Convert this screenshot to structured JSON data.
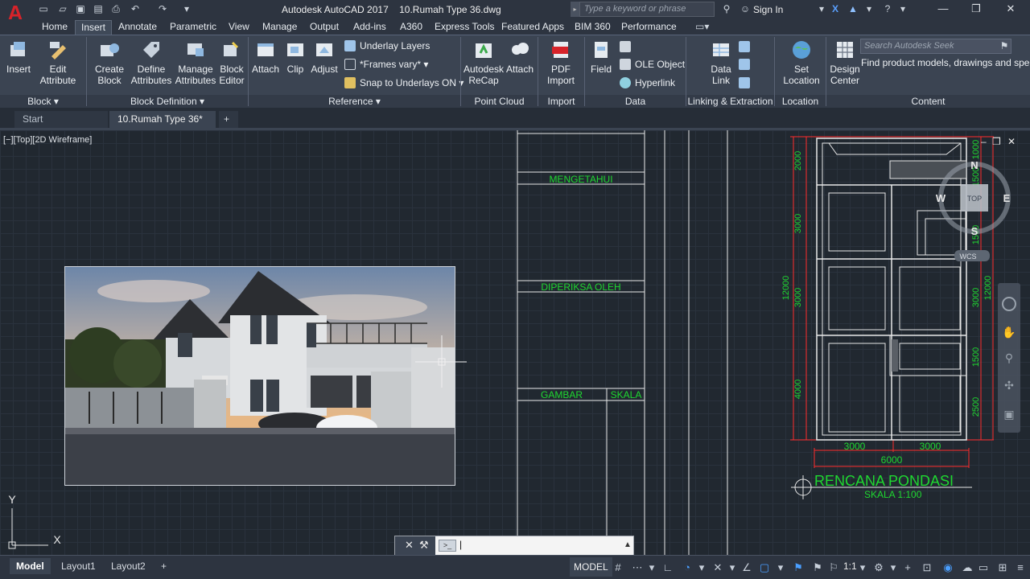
{
  "app": {
    "logo": "A",
    "title": "Autodesk AutoCAD 2017    10.Rumah Type 36.dwg",
    "search_placeholder": "Type a keyword or phrase",
    "sign_in": "Sign In"
  },
  "ribbon_tabs": [
    "Home",
    "Insert",
    "Annotate",
    "Parametric",
    "View",
    "Manage",
    "Output",
    "Add-ins",
    "A360",
    "Express Tools",
    "Featured Apps",
    "BIM 360",
    "Performance"
  ],
  "active_tab": "Insert",
  "ribbon": {
    "insert": "Insert",
    "edit_attribute": "Edit\nAttribute",
    "create_block": "Create\nBlock",
    "define_attributes": "Define\nAttributes",
    "manage_attributes": "Manage\nAttributes",
    "block_editor": "Block\nEditor",
    "attach": "Attach",
    "clip": "Clip",
    "adjust": "Adjust",
    "underlay_layers": "Underlay Layers",
    "frames_vary": "*Frames vary*",
    "snap_to_underlays": "Snap to Underlays ON",
    "autodesk_recap": "Autodesk\nReCap",
    "attach_pc": "Attach",
    "pdf_import": "PDF\nImport",
    "field": "Field",
    "ole_object": "OLE Object",
    "hyperlink": "Hyperlink",
    "data_link": "Data\nLink",
    "set_location": "Set\nLocation",
    "design_center": "Design\nCenter",
    "seek_placeholder": "Search Autodesk Seek",
    "seek_text": "Find product models, drawings and specs",
    "panels": [
      "Block",
      "Block Definition",
      "Reference",
      "Point Cloud",
      "Import",
      "Data",
      "Linking & Extraction",
      "Location",
      "Content"
    ]
  },
  "file_tabs": {
    "start": "Start",
    "current": "10.Rumah Type 36*"
  },
  "viewport_label": "[−][Top][2D Wireframe]",
  "drawing": {
    "title_block": [
      "MENGETAHUI",
      "DIPERIKSA  OLEH",
      "GAMBAR",
      "SKALA"
    ],
    "plan_title": "RENCANA PONDASI",
    "plan_scale": "SKALA  1:100",
    "dims_left": [
      "2000",
      "3000",
      "12000",
      "3000",
      "4000"
    ],
    "dims_right": [
      "1000",
      "1500",
      "1500",
      "12000",
      "3000",
      "1500",
      "2500"
    ],
    "dims_bottom": [
      "3000",
      "3000",
      "6000"
    ],
    "viewcube": {
      "top": "TOP",
      "n": "N",
      "s": "S",
      "e": "E",
      "w": "W",
      "wcs": "WCS"
    },
    "ucs": {
      "y": "Y",
      "x": "X"
    }
  },
  "status": {
    "layouts": [
      "Model",
      "Layout1",
      "Layout2"
    ],
    "model": "MODEL",
    "scale": "1:1"
  }
}
